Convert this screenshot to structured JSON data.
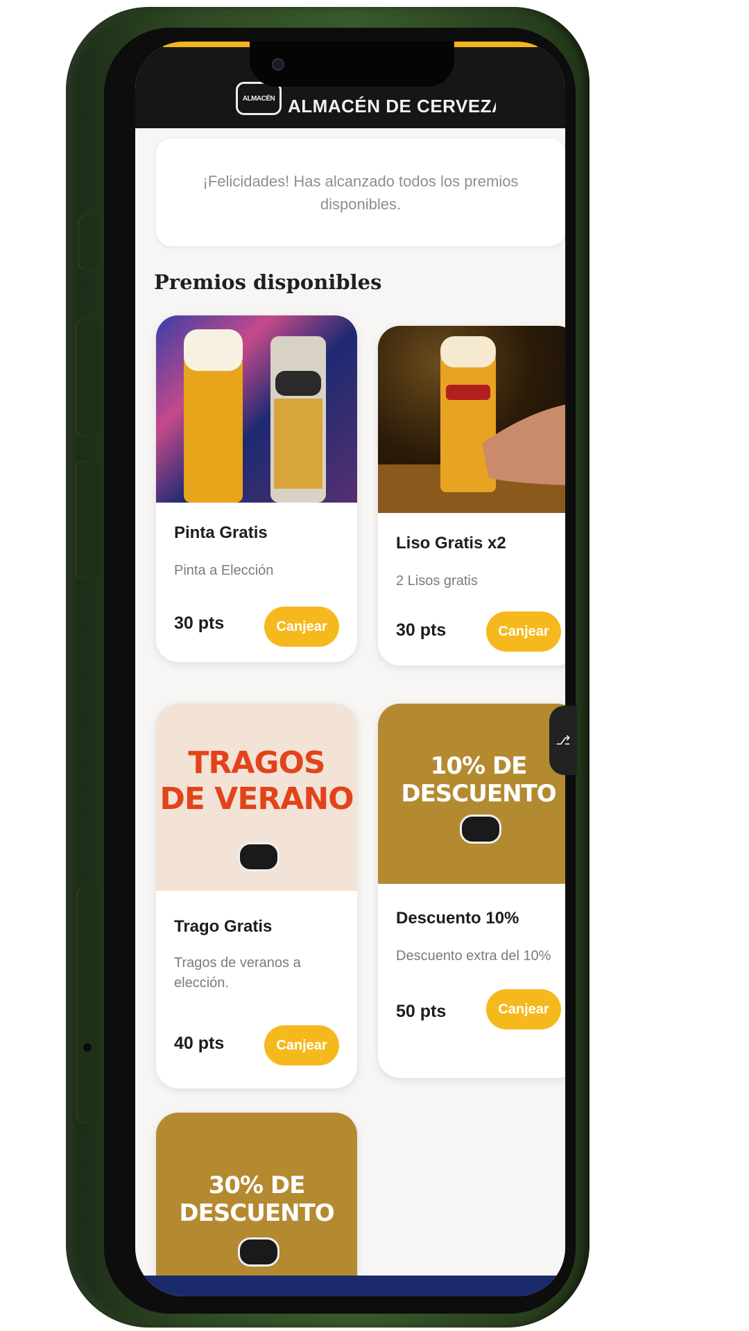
{
  "header": {
    "logo_text": "ALMACÉN",
    "brand_name": "ALMACÉN DE CERVEZAS"
  },
  "banner": {
    "message": "¡Felicidades! Has alcanzado todos los premios disponibles."
  },
  "section": {
    "title": "Premios disponibles"
  },
  "rewards": [
    {
      "title": "Pinta Gratis",
      "description": "Pinta a Elección",
      "points": "30 pts",
      "button": "Canjear",
      "image": "beer-glass-and-can-photo"
    },
    {
      "title": "Liso Gratis x2",
      "description": "2 Lisos gratis",
      "points": "30 pts",
      "button": "Canjear",
      "image": "hand-holding-beer-photo"
    },
    {
      "title": "Trago Gratis",
      "description": "Tragos de veranos a elección.",
      "points": "40 pts",
      "button": "Canjear",
      "image_text_1": "TRAGOS",
      "image_text_2": "DE VERANO"
    },
    {
      "title": "Descuento 10%",
      "description": "Descuento extra del 10%",
      "points": "50 pts",
      "button": "Canjear",
      "image_text": "10% DE DESCUENTO"
    },
    {
      "image_text": "30% DE DESCUENTO"
    }
  ],
  "colors": {
    "accent": "#f6b91d",
    "header_bg": "#161616",
    "phone_body": "#2f4a24",
    "promo_tan": "#b48a31",
    "promo_red": "#e2431b"
  }
}
